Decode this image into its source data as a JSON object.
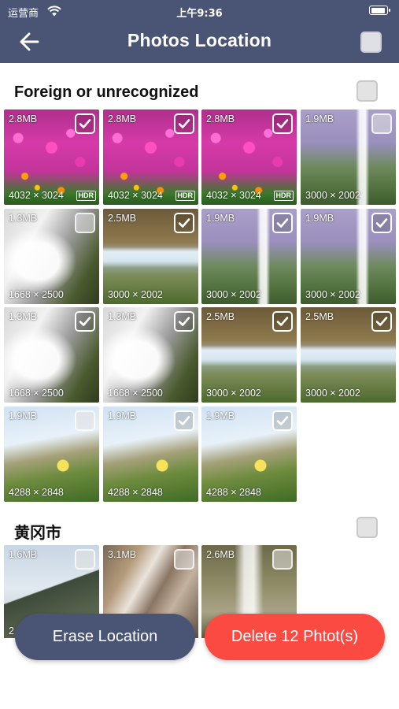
{
  "status_bar": {
    "carrier": "运营商",
    "time": "上午9:36"
  },
  "header": {
    "title": "Photos Location",
    "back_icon": "arrow-left-icon",
    "select_all_checked": false
  },
  "sections": [
    {
      "title": "Foreign or unrecognized",
      "checked": false,
      "photos": [
        {
          "size": "2.8MB",
          "dims": "4032 × 3024",
          "hdr": "HDR",
          "checked": true,
          "style": "flowers"
        },
        {
          "size": "2.8MB",
          "dims": "4032 × 3024",
          "hdr": "HDR",
          "checked": true,
          "style": "flowers"
        },
        {
          "size": "2.8MB",
          "dims": "4032 × 3024",
          "hdr": "HDR",
          "checked": true,
          "style": "flowers"
        },
        {
          "size": "1.9MB",
          "dims": "3000 × 2002",
          "hdr": "",
          "checked": false,
          "style": "falls1"
        },
        {
          "size": "1.3MB",
          "dims": "1668 × 2500",
          "hdr": "",
          "checked": false,
          "style": "falls2"
        },
        {
          "size": "2.5MB",
          "dims": "3000 × 2002",
          "hdr": "",
          "checked": true,
          "style": "falls3"
        },
        {
          "size": "1.9MB",
          "dims": "3000 × 2002",
          "hdr": "",
          "checked": true,
          "style": "falls1"
        },
        {
          "size": "1.9MB",
          "dims": "3000 × 2002",
          "hdr": "",
          "checked": true,
          "style": "falls1"
        },
        {
          "size": "1.3MB",
          "dims": "1668 × 2500",
          "hdr": "",
          "checked": true,
          "style": "falls2"
        },
        {
          "size": "1.3MB",
          "dims": "1668 × 2500",
          "hdr": "",
          "checked": true,
          "style": "falls2"
        },
        {
          "size": "2.5MB",
          "dims": "3000 × 2002",
          "hdr": "",
          "checked": true,
          "style": "falls3"
        },
        {
          "size": "2.5MB",
          "dims": "3000 × 2002",
          "hdr": "",
          "checked": true,
          "style": "falls3"
        },
        {
          "size": "1.9MB",
          "dims": "4288 × 2848",
          "hdr": "",
          "checked": false,
          "style": "meadow"
        },
        {
          "size": "1.9MB",
          "dims": "4288 × 2848",
          "hdr": "",
          "checked": true,
          "style": "meadow"
        },
        {
          "size": "1.9MB",
          "dims": "4288 × 2848",
          "hdr": "",
          "checked": true,
          "style": "meadow"
        }
      ]
    },
    {
      "title": "黄冈市",
      "checked": false,
      "photos": [
        {
          "size": "1.6MB",
          "dims": "2",
          "hdr": "",
          "checked": false,
          "style": "mountain"
        },
        {
          "size": "3.1MB",
          "dims": "",
          "hdr": "",
          "checked": false,
          "style": "rocks"
        },
        {
          "size": "2.6MB",
          "dims": "",
          "hdr": "",
          "checked": false,
          "style": "cascade"
        }
      ]
    }
  ],
  "buttons": {
    "erase": "Erase Location",
    "delete": "Delete 12 Phtot(s)"
  },
  "colors": {
    "header_bg": "#4a5575",
    "erase_bg": "#4a5575",
    "delete_bg": "#fb4a41"
  }
}
